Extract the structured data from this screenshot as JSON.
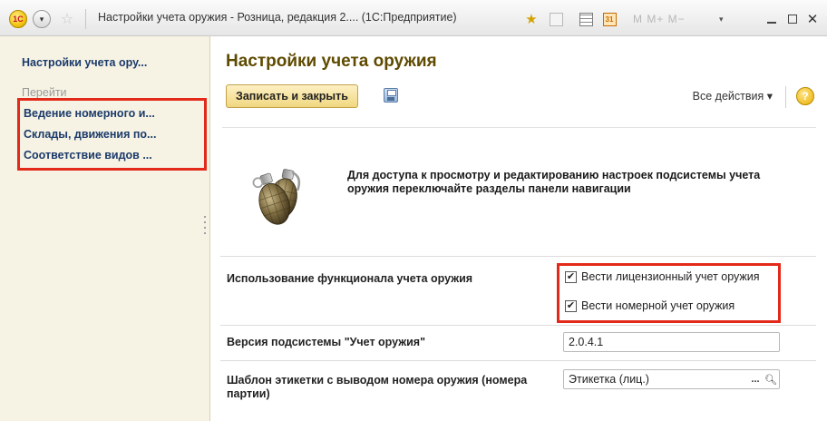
{
  "window": {
    "logo_text": "1С",
    "menu_glyph": "▾",
    "star_glyph": "☆",
    "title": "Настройки учета оружия - Розница, редакция 2.... (1С:Предприятие)",
    "calendar_glyph": "31",
    "memory_buttons": "M  M+  M−",
    "dropdown_glyph": "▾",
    "close_glyph": "✕"
  },
  "sidebar": {
    "title": "Настройки учета ору...",
    "goto_label": "Перейти",
    "links": [
      "Ведение номерного и...",
      "Склады, движения по...",
      "Соответствие видов ..."
    ]
  },
  "main": {
    "title": "Настройки учета оружия",
    "toolbar": {
      "save_close_label": "Записать и закрыть",
      "all_actions_label": "Все действия ▾",
      "help_glyph": "?"
    },
    "info_text": "Для доступа к просмотру и редактированию настроек подсистемы учета оружия переключайте разделы панели навигации",
    "sections": {
      "functional": {
        "label": "Использование функционала учета оружия",
        "checkboxes": [
          {
            "label": "Вести лицензионный учет оружия",
            "checked": true
          },
          {
            "label": "Вести номерной учет оружия",
            "checked": true
          }
        ]
      },
      "version": {
        "label": "Версия подсистемы \"Учет оружия\"",
        "value": "2.0.4.1"
      },
      "template": {
        "label": "Шаблон этикетки с выводом номера оружия (номера партии)",
        "value": "Этикетка (лиц.)",
        "choose_glyph": "...",
        "open_glyph": "🔍︎"
      }
    }
  }
}
